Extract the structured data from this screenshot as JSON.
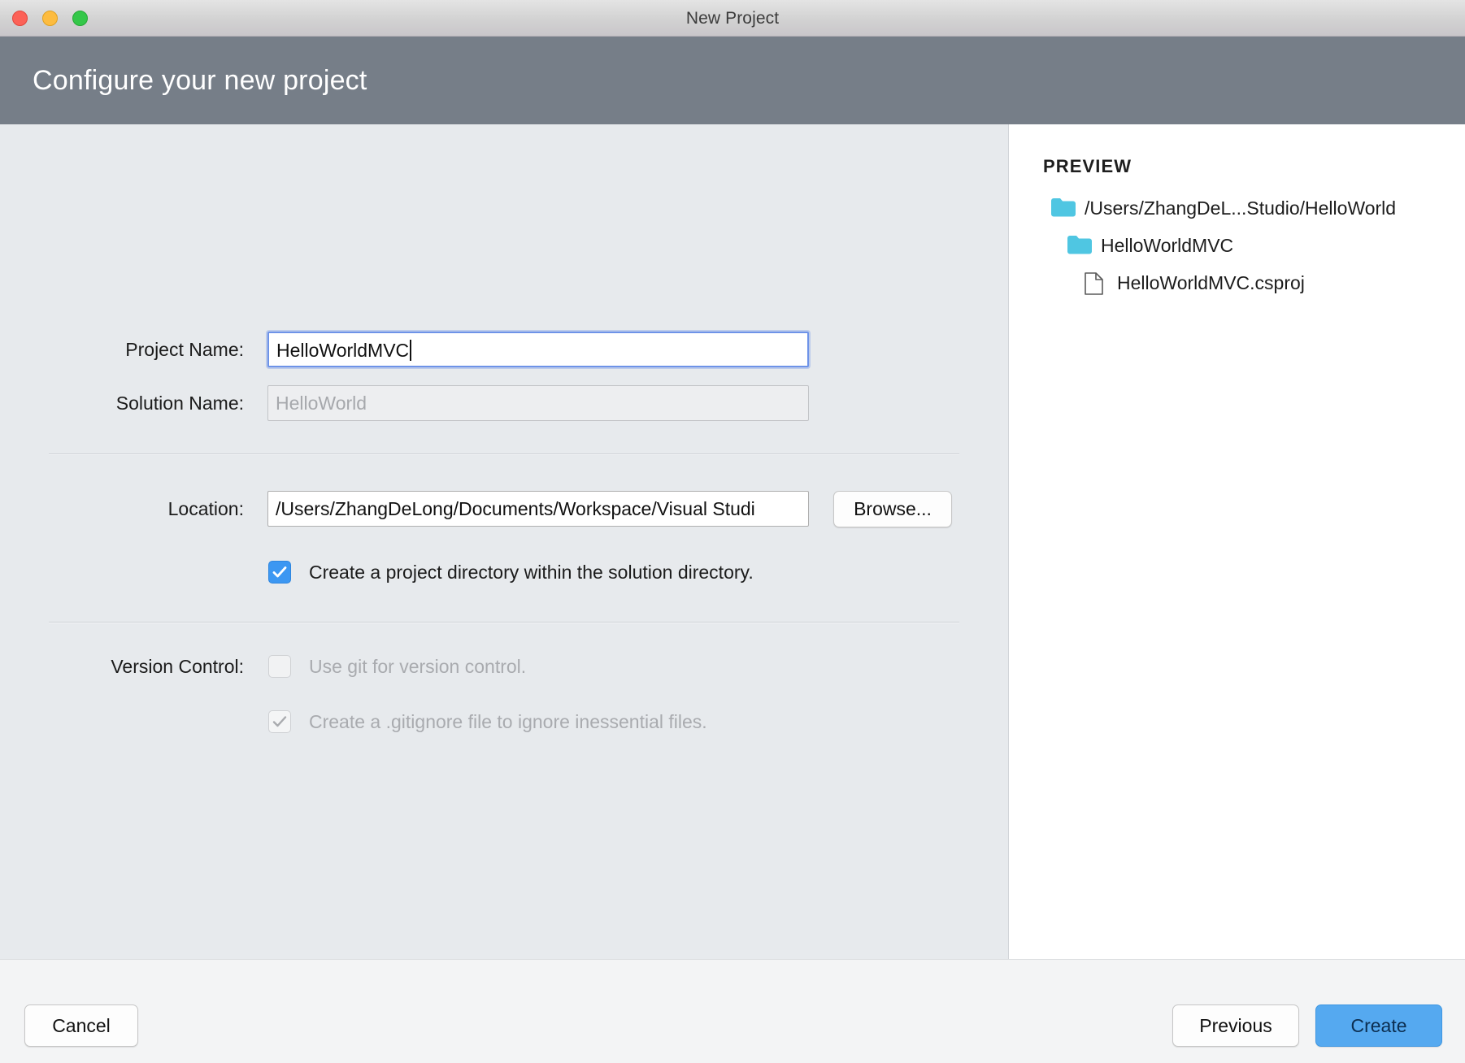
{
  "window": {
    "title": "New Project",
    "traffic_lights": [
      "close-button",
      "minimize-button",
      "maximize-button"
    ]
  },
  "header": {
    "title": "Configure your new project",
    "background": "#767E88"
  },
  "form": {
    "project_name": {
      "label": "Project Name:",
      "value": "HelloWorldMVC",
      "focused": true
    },
    "solution_name": {
      "label": "Solution Name:",
      "value": "",
      "placeholder": "HelloWorld",
      "readonly": true
    },
    "location": {
      "label": "Location:",
      "value": "/Users/ZhangDeLong/Documents/Workspace/Visual Studi",
      "browse_label": "Browse..."
    },
    "create_project_directory": {
      "label": "Create a project directory within the solution directory.",
      "checked": true,
      "enabled": true
    },
    "version_control": {
      "label": "Version Control:",
      "use_git": {
        "label": "Use git for version control.",
        "checked": false,
        "enabled": false
      },
      "gitignore": {
        "label": "Create a .gitignore file to ignore inessential files.",
        "checked": true,
        "enabled": false
      }
    }
  },
  "preview": {
    "title": "PREVIEW",
    "folder_color": "#4FC6E2",
    "tree": [
      {
        "label": "/Users/ZhangDeL...Studio/HelloWorld",
        "icon": "folder-icon",
        "depth": 0
      },
      {
        "label": "HelloWorldMVC",
        "icon": "folder-icon",
        "depth": 1
      },
      {
        "label": "HelloWorldMVC.csproj",
        "icon": "file-icon",
        "depth": 2
      }
    ]
  },
  "footer": {
    "cancel_label": "Cancel",
    "previous_label": "Previous",
    "create_label": "Create",
    "create_color": "#55A9F0"
  }
}
